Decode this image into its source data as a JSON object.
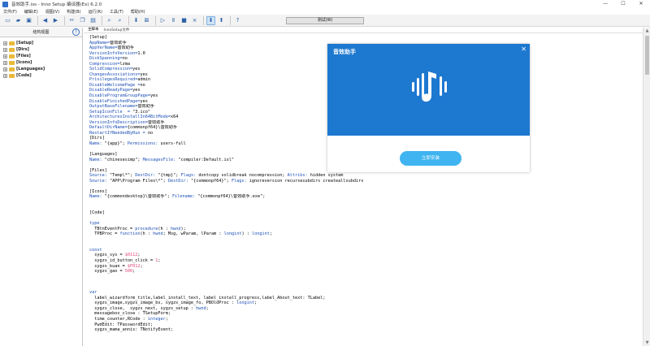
{
  "window": {
    "title": "音效助手.iss - Inno Setup 编译器(Ex) 6.2.0",
    "controls": [
      "—",
      "☐",
      "✕"
    ]
  },
  "menu": [
    "文件(F)",
    "编辑(E)",
    "视图(V)",
    "构建(B)",
    "运行(R)",
    "工具(T)",
    "帮助(H)"
  ],
  "toolbar": {
    "test_button": "测试(W)"
  },
  "tree": {
    "header": "结构视图",
    "help": "?",
    "items": [
      "[Setup]",
      "[Dirs]",
      "[Files]",
      "[Icons]",
      "[Languages]",
      "[Code]"
    ]
  },
  "editor": {
    "tabs": [
      "主脚本",
      "InnoSetup文件"
    ],
    "lines": [
      [
        {
          "t": "[Setup]",
          "c": ""
        }
      ],
      [
        {
          "t": "AppName=",
          "c": "k"
        },
        {
          "t": "音效助手",
          "c": ""
        }
      ],
      [
        {
          "t": "AppVerName=",
          "c": "k"
        },
        {
          "t": "音效助手",
          "c": ""
        }
      ],
      [
        {
          "t": "VersionInfoVersion=",
          "c": "k"
        },
        {
          "t": "1.0",
          "c": ""
        }
      ],
      [
        {
          "t": "DiskSpanning=",
          "c": "k"
        },
        {
          "t": "no",
          "c": ""
        }
      ],
      [
        {
          "t": "Compression=",
          "c": "k"
        },
        {
          "t": "lzma",
          "c": ""
        }
      ],
      [
        {
          "t": "SolidCompression=",
          "c": "k"
        },
        {
          "t": "yes",
          "c": ""
        }
      ],
      [
        {
          "t": "ChangesAssociations=",
          "c": "k"
        },
        {
          "t": "yes",
          "c": ""
        }
      ],
      [
        {
          "t": "PrivilegesRequired=",
          "c": "k"
        },
        {
          "t": "admin",
          "c": ""
        }
      ],
      [
        {
          "t": "DisableWelcomePage =",
          "c": "k"
        },
        {
          "t": "no",
          "c": ""
        }
      ],
      [
        {
          "t": "DisableReadyPage=",
          "c": "k"
        },
        {
          "t": "yes",
          "c": ""
        }
      ],
      [
        {
          "t": "DisableProgramGroupPage=",
          "c": "k"
        },
        {
          "t": "yes",
          "c": ""
        }
      ],
      [
        {
          "t": "DisableFinishedPage=",
          "c": "k"
        },
        {
          "t": "yes",
          "c": ""
        }
      ],
      [
        {
          "t": "OutputBaseFilename=",
          "c": "k"
        },
        {
          "t": "音效助手",
          "c": ""
        }
      ],
      [
        {
          "t": "SetupIconFile  = ",
          "c": "k"
        },
        {
          "t": "\"3.ico\"",
          "c": ""
        }
      ],
      [
        {
          "t": "ArchitecturesInstallIn64BitMode=",
          "c": "k"
        },
        {
          "t": "x64",
          "c": ""
        }
      ],
      [
        {
          "t": "VersionInfoDescription=",
          "c": "k"
        },
        {
          "t": "音效助手",
          "c": ""
        }
      ],
      [
        {
          "t": "DefaultDirName=",
          "c": "k"
        },
        {
          "t": "{commonpf64}\\音效助手",
          "c": ""
        }
      ],
      [
        {
          "t": "RestartIfNeededByRun = ",
          "c": "k"
        },
        {
          "t": "no",
          "c": ""
        }
      ],
      [
        {
          "t": "[Dirs]",
          "c": ""
        }
      ],
      [
        {
          "t": "Name: ",
          "c": "k"
        },
        {
          "t": "\"{app}\"; ",
          "c": ""
        },
        {
          "t": "Permissions: ",
          "c": "k"
        },
        {
          "t": "users-full",
          "c": ""
        }
      ],
      [
        {
          "t": "",
          "c": ""
        }
      ],
      [
        {
          "t": "[Languages]",
          "c": ""
        }
      ],
      [
        {
          "t": "Name: ",
          "c": "k"
        },
        {
          "t": "\"chinesesimp\"; ",
          "c": ""
        },
        {
          "t": "MessagesFile: ",
          "c": "k"
        },
        {
          "t": "\"compiler:Default.isl\"",
          "c": ""
        }
      ],
      [
        {
          "t": "",
          "c": ""
        }
      ],
      [
        {
          "t": "[Files]",
          "c": ""
        }
      ],
      [
        {
          "t": "Source: ",
          "c": "k"
        },
        {
          "t": "\"Temp\\*\"; ",
          "c": ""
        },
        {
          "t": "DestDir: ",
          "c": "k"
        },
        {
          "t": "\"{tmp}\"; ",
          "c": ""
        },
        {
          "t": "Flags: ",
          "c": "k"
        },
        {
          "t": "dontcopy solidbreak nocompression; ",
          "c": ""
        },
        {
          "t": "Attribs: ",
          "c": "k"
        },
        {
          "t": "hidden system",
          "c": ""
        }
      ],
      [
        {
          "t": "Source: ",
          "c": "k"
        },
        {
          "t": "\"APP\\Program Files\\*\"; ",
          "c": ""
        },
        {
          "t": "DestDir: ",
          "c": "k"
        },
        {
          "t": "\"{commonpf64}\"; ",
          "c": ""
        },
        {
          "t": "Flags: ",
          "c": "k"
        },
        {
          "t": "ignoreversion recursesubdirs createallsubdirs",
          "c": ""
        }
      ],
      [
        {
          "t": "",
          "c": ""
        }
      ],
      [
        {
          "t": "[Icons]",
          "c": ""
        }
      ],
      [
        {
          "t": "Name: ",
          "c": "k"
        },
        {
          "t": "\"{commondesktop}\\音效助手\"; ",
          "c": ""
        },
        {
          "t": "Filename: ",
          "c": "k"
        },
        {
          "t": "\"{commonpf64}\\音效助手.exe\";",
          "c": ""
        }
      ],
      [
        {
          "t": "",
          "c": ""
        }
      ],
      [
        {
          "t": "",
          "c": ""
        }
      ],
      [
        {
          "t": "[Code]",
          "c": ""
        }
      ],
      [
        {
          "t": "",
          "c": ""
        }
      ],
      [
        {
          "t": "type",
          "c": "k"
        }
      ],
      [
        {
          "t": "  TBtnEventProc = ",
          "c": ""
        },
        {
          "t": "procedure",
          "c": "k"
        },
        {
          "t": "(h : ",
          "c": ""
        },
        {
          "t": "hwnd",
          "c": "k"
        },
        {
          "t": ");",
          "c": ""
        }
      ],
      [
        {
          "t": "  TPBProc = ",
          "c": ""
        },
        {
          "t": "function",
          "c": "k"
        },
        {
          "t": "(h : ",
          "c": ""
        },
        {
          "t": "hwnd",
          "c": "k"
        },
        {
          "t": "; Msg, wParam, lParam : ",
          "c": ""
        },
        {
          "t": "longint",
          "c": "k"
        },
        {
          "t": ") : ",
          "c": ""
        },
        {
          "t": "longint",
          "c": "k"
        },
        {
          "t": ";",
          "c": ""
        }
      ],
      [
        {
          "t": "",
          "c": ""
        }
      ],
      [
        {
          "t": "",
          "c": ""
        }
      ],
      [
        {
          "t": "const",
          "c": "k"
        }
      ],
      [
        {
          "t": "  sygzs_sys = ",
          "c": ""
        },
        {
          "t": "$0112",
          "c": "v"
        },
        {
          "t": ";",
          "c": ""
        }
      ],
      [
        {
          "t": "  sygzs_id_button_click = ",
          "c": ""
        },
        {
          "t": "1",
          "c": "v"
        },
        {
          "t": ";",
          "c": ""
        }
      ],
      [
        {
          "t": "  sygzs_kuan = ",
          "c": ""
        },
        {
          "t": "$F012",
          "c": "v"
        },
        {
          "t": ";",
          "c": ""
        }
      ],
      [
        {
          "t": "  sygzs_gao = ",
          "c": ""
        },
        {
          "t": "500",
          "c": "v"
        },
        {
          "t": ";",
          "c": ""
        }
      ],
      [
        {
          "t": "",
          "c": ""
        }
      ],
      [
        {
          "t": "",
          "c": ""
        }
      ],
      [
        {
          "t": "",
          "c": ""
        }
      ],
      [
        {
          "t": "var",
          "c": "k"
        }
      ],
      [
        {
          "t": "  label_wizardform_title,label_install_text, label_install_progress,label_About_text: TLabel;",
          "c": ""
        }
      ],
      [
        {
          "t": "  sygzs_image,sygzs_image_bs, sygzs_image_fo, PBOldProc : ",
          "c": ""
        },
        {
          "t": "longint",
          "c": "k"
        },
        {
          "t": ";",
          "c": ""
        }
      ],
      [
        {
          "t": "  sygzs_close,  sygzs_next, sygzs_setup : ",
          "c": ""
        },
        {
          "t": "hwnd",
          "c": "k"
        },
        {
          "t": ";",
          "c": ""
        }
      ],
      [
        {
          "t": "  messagebox_close : TSetupForm;",
          "c": ""
        }
      ],
      [
        {
          "t": "  time_counter,RCode : ",
          "c": ""
        },
        {
          "t": "integer",
          "c": "k"
        },
        {
          "t": ";",
          "c": ""
        }
      ],
      [
        {
          "t": "  PwdEdit: TPasswordEdit;",
          "c": ""
        }
      ],
      [
        {
          "t": "  sygzs_mama_annis: TNotifyEvent;",
          "c": ""
        }
      ]
    ]
  },
  "preview": {
    "title": "音效助手",
    "close": "✕",
    "install_button": "立即安装",
    "colors": {
      "header": "#1d78d0",
      "button": "#3fb4f0"
    }
  }
}
